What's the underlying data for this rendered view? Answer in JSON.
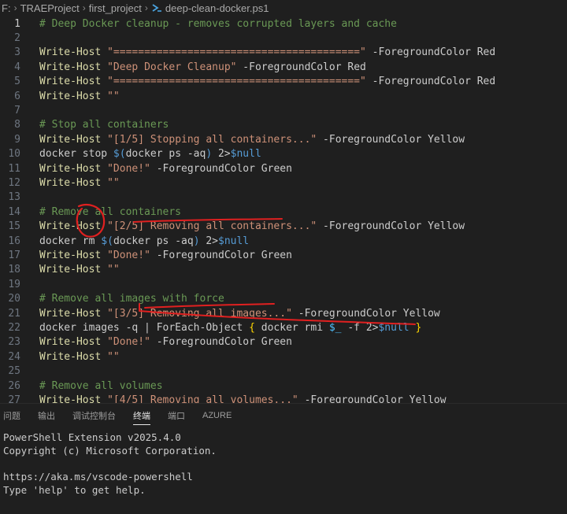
{
  "breadcrumb": {
    "drive": "F:",
    "folder1": "TRAEProject",
    "folder2": "first_project",
    "file": "deep-clean-docker.ps1"
  },
  "editor": {
    "active_line": 1,
    "lines": [
      {
        "n": "1",
        "tokens": [
          {
            "t": "# Deep Docker cleanup - removes corrupted layers and cache",
            "c": "cmt"
          }
        ]
      },
      {
        "n": "2",
        "tokens": []
      },
      {
        "n": "3",
        "tokens": [
          {
            "t": "Write-Host",
            "c": "cmd"
          },
          {
            "t": " ",
            "c": "par"
          },
          {
            "t": "\"========================================\"",
            "c": "str"
          },
          {
            "t": " -ForegroundColor Red",
            "c": "par"
          }
        ]
      },
      {
        "n": "4",
        "tokens": [
          {
            "t": "Write-Host",
            "c": "cmd"
          },
          {
            "t": " ",
            "c": "par"
          },
          {
            "t": "\"Deep Docker Cleanup\"",
            "c": "str"
          },
          {
            "t": " -ForegroundColor Red",
            "c": "par"
          }
        ]
      },
      {
        "n": "5",
        "tokens": [
          {
            "t": "Write-Host",
            "c": "cmd"
          },
          {
            "t": " ",
            "c": "par"
          },
          {
            "t": "\"========================================\"",
            "c": "str"
          },
          {
            "t": " -ForegroundColor Red",
            "c": "par"
          }
        ]
      },
      {
        "n": "6",
        "tokens": [
          {
            "t": "Write-Host",
            "c": "cmd"
          },
          {
            "t": " ",
            "c": "par"
          },
          {
            "t": "\"\"",
            "c": "str"
          }
        ]
      },
      {
        "n": "7",
        "tokens": []
      },
      {
        "n": "8",
        "tokens": [
          {
            "t": "# Stop all containers",
            "c": "cmt"
          }
        ]
      },
      {
        "n": "9",
        "tokens": [
          {
            "t": "Write-Host",
            "c": "cmd"
          },
          {
            "t": " ",
            "c": "par"
          },
          {
            "t": "\"[1/5] Stopping all containers...\"",
            "c": "str"
          },
          {
            "t": " -ForegroundColor Yellow",
            "c": "par"
          }
        ]
      },
      {
        "n": "10",
        "tokens": [
          {
            "t": "docker stop ",
            "c": "par"
          },
          {
            "t": "$(",
            "c": "kw"
          },
          {
            "t": "docker ps -aq",
            "c": "par"
          },
          {
            "t": ")",
            "c": "kw"
          },
          {
            "t": " 2>",
            "c": "par"
          },
          {
            "t": "$null",
            "c": "kw"
          }
        ]
      },
      {
        "n": "11",
        "tokens": [
          {
            "t": "Write-Host",
            "c": "cmd"
          },
          {
            "t": " ",
            "c": "par"
          },
          {
            "t": "\"Done!\"",
            "c": "str"
          },
          {
            "t": " -ForegroundColor Green",
            "c": "par"
          }
        ]
      },
      {
        "n": "12",
        "tokens": [
          {
            "t": "Write-Host",
            "c": "cmd"
          },
          {
            "t": " ",
            "c": "par"
          },
          {
            "t": "\"\"",
            "c": "str"
          }
        ]
      },
      {
        "n": "13",
        "tokens": []
      },
      {
        "n": "14",
        "tokens": [
          {
            "t": "# Remove all containers",
            "c": "cmt"
          }
        ]
      },
      {
        "n": "15",
        "tokens": [
          {
            "t": "Write-Host",
            "c": "cmd"
          },
          {
            "t": " ",
            "c": "par"
          },
          {
            "t": "\"[2/5] Removing all containers...\"",
            "c": "str"
          },
          {
            "t": " -ForegroundColor Yellow",
            "c": "par"
          }
        ]
      },
      {
        "n": "16",
        "tokens": [
          {
            "t": "docker rm ",
            "c": "par"
          },
          {
            "t": "$(",
            "c": "kw"
          },
          {
            "t": "docker ps -aq",
            "c": "par"
          },
          {
            "t": ")",
            "c": "kw"
          },
          {
            "t": " 2>",
            "c": "par"
          },
          {
            "t": "$null",
            "c": "kw"
          }
        ]
      },
      {
        "n": "17",
        "tokens": [
          {
            "t": "Write-Host",
            "c": "cmd"
          },
          {
            "t": " ",
            "c": "par"
          },
          {
            "t": "\"Done!\"",
            "c": "str"
          },
          {
            "t": " -ForegroundColor Green",
            "c": "par"
          }
        ]
      },
      {
        "n": "18",
        "tokens": [
          {
            "t": "Write-Host",
            "c": "cmd"
          },
          {
            "t": " ",
            "c": "par"
          },
          {
            "t": "\"\"",
            "c": "str"
          }
        ]
      },
      {
        "n": "19",
        "tokens": []
      },
      {
        "n": "20",
        "tokens": [
          {
            "t": "# Remove all images with force",
            "c": "cmt"
          }
        ]
      },
      {
        "n": "21",
        "tokens": [
          {
            "t": "Write-Host",
            "c": "cmd"
          },
          {
            "t": " ",
            "c": "par"
          },
          {
            "t": "\"[3/5] Removing all images...\"",
            "c": "str"
          },
          {
            "t": " -ForegroundColor Yellow",
            "c": "par"
          }
        ]
      },
      {
        "n": "22",
        "tokens": [
          {
            "t": "docker images -q | ForEach-Object ",
            "c": "par"
          },
          {
            "t": "{",
            "c": "br"
          },
          {
            "t": " docker rmi ",
            "c": "par"
          },
          {
            "t": "$_",
            "c": "var"
          },
          {
            "t": " -f 2>",
            "c": "par"
          },
          {
            "t": "$null",
            "c": "kw"
          },
          {
            "t": " ",
            "c": "par"
          },
          {
            "t": "}",
            "c": "br"
          }
        ]
      },
      {
        "n": "23",
        "tokens": [
          {
            "t": "Write-Host",
            "c": "cmd"
          },
          {
            "t": " ",
            "c": "par"
          },
          {
            "t": "\"Done!\"",
            "c": "str"
          },
          {
            "t": " -ForegroundColor Green",
            "c": "par"
          }
        ]
      },
      {
        "n": "24",
        "tokens": [
          {
            "t": "Write-Host",
            "c": "cmd"
          },
          {
            "t": " ",
            "c": "par"
          },
          {
            "t": "\"\"",
            "c": "str"
          }
        ]
      },
      {
        "n": "25",
        "tokens": []
      },
      {
        "n": "26",
        "tokens": [
          {
            "t": "# Remove all volumes",
            "c": "cmt"
          }
        ]
      },
      {
        "n": "27",
        "tokens": [
          {
            "t": "Write-Host",
            "c": "cmd"
          },
          {
            "t": " ",
            "c": "par"
          },
          {
            "t": "\"[4/5] Removing all volumes...\"",
            "c": "str"
          },
          {
            "t": " -ForegroundColor Yellow",
            "c": "par"
          }
        ]
      }
    ]
  },
  "panel": {
    "tabs": [
      {
        "label": "问题",
        "active": false
      },
      {
        "label": "输出",
        "active": false
      },
      {
        "label": "调试控制台",
        "active": false
      },
      {
        "label": "终端",
        "active": true
      },
      {
        "label": "端口",
        "active": false
      },
      {
        "label": "AZURE",
        "active": false
      }
    ]
  },
  "terminal": {
    "lines": [
      "PowerShell Extension v2025.4.0",
      "Copyright (c) Microsoft Corporation.",
      "",
      "https://aka.ms/vscode-powershell",
      "Type 'help' to get help."
    ]
  },
  "colors": {
    "background": "#1f1f1f",
    "annotation": "#e02020",
    "powershell_icon": "#4aa3df"
  }
}
